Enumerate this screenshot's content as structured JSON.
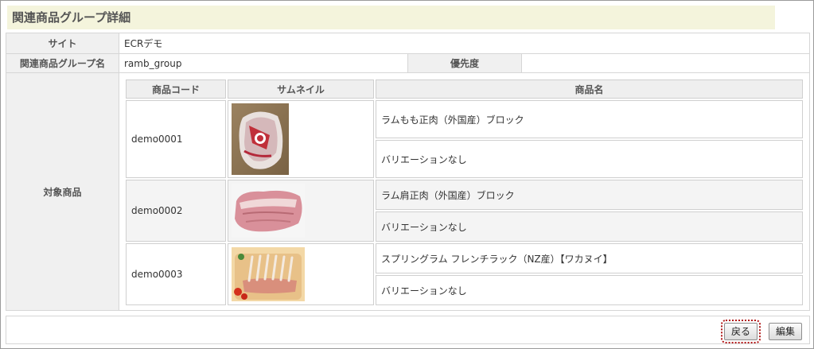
{
  "page": {
    "title": "関連商品グループ詳細"
  },
  "fields": {
    "site_label": "サイト",
    "site_value": "ECRデモ",
    "group_name_label": "関連商品グループ名",
    "group_name_value": "ramb_group",
    "priority_label": "優先度",
    "priority_value": "",
    "target_label": "対象商品"
  },
  "products": {
    "headers": {
      "code": "商品コード",
      "thumbnail": "サムネイル",
      "name": "商品名"
    },
    "rows": [
      {
        "code": "demo0001",
        "name": "ラムもも正肉（外国産）ブロック",
        "variation": "バリエーションなし",
        "thumbnail_icon": "lamb-leg-package-image"
      },
      {
        "code": "demo0002",
        "name": "ラム肩正肉（外国産）ブロック",
        "variation": "バリエーションなし",
        "thumbnail_icon": "lamb-shoulder-block-image"
      },
      {
        "code": "demo0003",
        "name": "スプリングラム フレンチラック（NZ産）【ワカヌイ】",
        "variation": "バリエーションなし",
        "thumbnail_icon": "lamb-rack-image"
      }
    ]
  },
  "buttons": {
    "back": "戻る",
    "edit": "編集"
  },
  "colors": {
    "title_bg": "#f4f4dc",
    "header_bg": "#f0f0f0",
    "focus_outline": "#b01818"
  }
}
